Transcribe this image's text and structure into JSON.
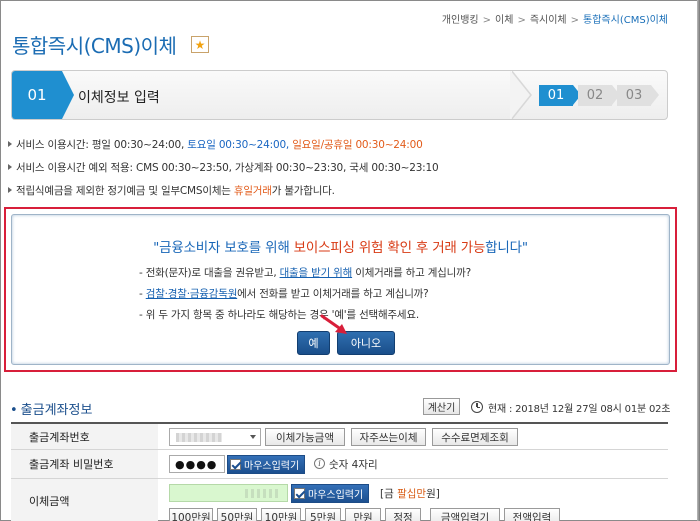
{
  "breadcrumb": [
    "개인뱅킹",
    "이체",
    "즉시이체",
    "통합즉시(CMS)이체"
  ],
  "page_title": "통합즉시(CMS)이체",
  "favorite_icon": "star-icon",
  "step": {
    "current_number": "01",
    "current_label": "이체정보 입력",
    "indicators": [
      "01",
      "02",
      "03"
    ]
  },
  "notices": {
    "n1_a": "서비스 이용시간: 평일 00:30~24:00, ",
    "n1_b": "토요일 00:30~24:00, ",
    "n1_c": "일요일/공휴일 00:30~24:00",
    "n2": "서비스 이용시간 예외 적용: CMS 00:30~23:50, 가상계좌 00:30~23:30, 국세 00:30~23:10",
    "n3_a": "적립식예금을 제외한 정기예금 및 일부CMS이체는 ",
    "n3_b": "휴일거래",
    "n3_c": "가 불가합니다."
  },
  "alert": {
    "title_a": "\"금융소비자 보호를 위해 ",
    "title_b": "보이스피싱 위험 확인 후 거래 가능",
    "title_c": "합니다\"",
    "line1_a": "- 전화(문자)로 대출을 권유받고, ",
    "line1_link": "대출을 받기 위해",
    "line1_b": " 이체거래를 하고 계십니까?",
    "line2_a": "- ",
    "line2_link": "검찰·경찰·금융감독원",
    "line2_b": "에서 전화를 받고 이체거래를 하고 계십니까?",
    "line3": "- 위 두 가지 항목 중 하나라도 해당하는 경우 '예'를 선택해주세요.",
    "yes_label": "예",
    "no_label": "아니오"
  },
  "withdraw": {
    "section_title": "출금계좌정보",
    "calc_label": "계산기",
    "now_text": "현재 : 2018년 12월 27일 08시 01분 02초",
    "rows": {
      "account_label": "출금계좌번호",
      "account_btn1": "이체가능금액",
      "account_btn2": "자주쓰는이체",
      "account_btn3": "수수료면제조회",
      "pw_label": "출금계좌 비밀번호",
      "pw_value": "●●●●",
      "mouse_input_label": "마우스입력기",
      "pw_hint": "숫자 4자리",
      "amount_label": "이체금액",
      "amount_prefix": "[금 ",
      "amount_korean": "팔십만",
      "amount_suffix": "원]",
      "quick_amounts": [
        "100만원",
        "50만원",
        "10만원",
        "5만원",
        "만원",
        "정정",
        "금액입력기",
        "전액입력"
      ]
    }
  },
  "colors": {
    "brand_blue": "#1b6cb3",
    "step_blue": "#1f8fd0",
    "alert_red_border": "#d81f3a",
    "highlight_orange": "#e25b1a",
    "button_navy": "#1a4e8a",
    "amount_green": "#d9f7cf"
  }
}
